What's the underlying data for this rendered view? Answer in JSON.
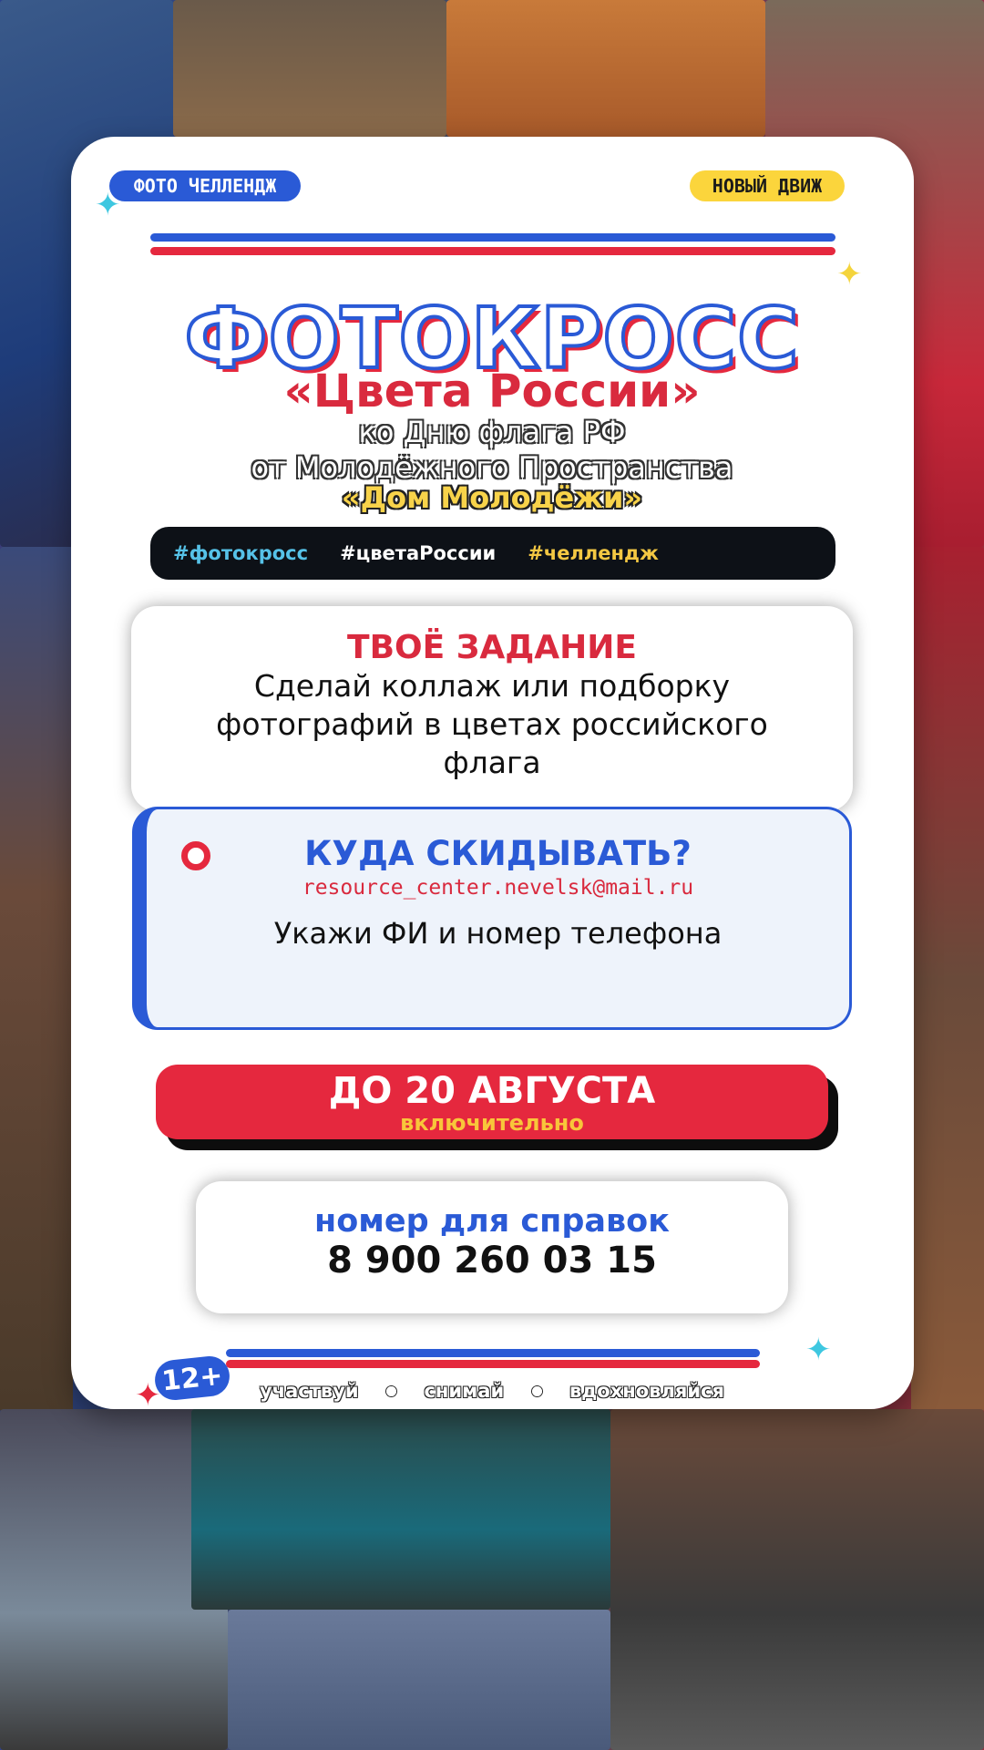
{
  "badges": {
    "left": "ФОТО ЧЕЛЛЕНДЖ",
    "right": "НОВЫЙ ДВИЖ"
  },
  "header": {
    "title": "ФОТОКРОСС",
    "subtitle": "«Цвета России»",
    "line1": "ко Дню флага РФ",
    "line2": "от Молодёжного Пространства",
    "line3": "«Дом Молодёжи»"
  },
  "hashtags": [
    "#фотокросс",
    "#цветаРоссии",
    "#челлендж"
  ],
  "task": {
    "title": "ТВОЁ ЗАДАНИЕ",
    "line1": "Сделай коллаж или подборку",
    "line2": "фотографий в цветах российского",
    "line3": "флага"
  },
  "submit": {
    "title": "КУДА СКИДЫВАТЬ?",
    "email": "resource_center.nevelsk@mail.ru",
    "note": "Укажи ФИ и номер телефона"
  },
  "deadline": {
    "main": "ДО 20 АВГУСТА",
    "sub": "включительно"
  },
  "contact": {
    "label": "номер для справок",
    "phone": "8 900 260 03 15"
  },
  "footer": {
    "age": "12+",
    "words": [
      "участвуй",
      "снимай",
      "вдохновляйся"
    ]
  },
  "colors": {
    "blue": "#2a5ad6",
    "red": "#e5283e",
    "yellow": "#fbd53c",
    "dark": "#0d1117"
  },
  "icons": [
    "sparkle-icon",
    "circle-bullet-icon"
  ]
}
